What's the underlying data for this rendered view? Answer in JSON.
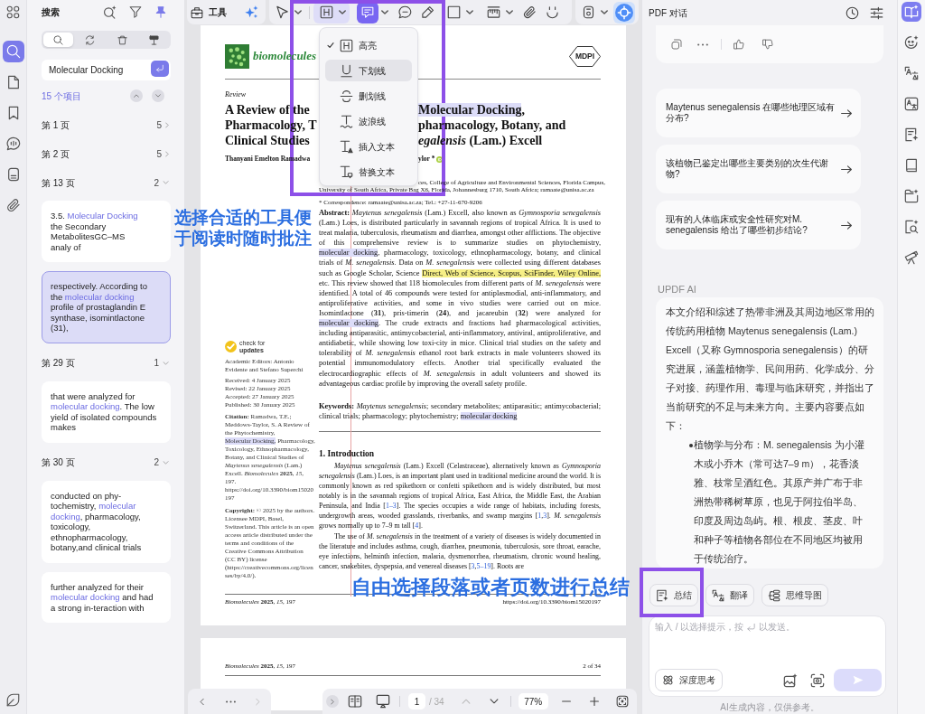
{
  "left_rail": [
    {
      "kind": "search",
      "selected": true
    },
    {
      "kind": "pages",
      "selected": false
    },
    {
      "kind": "bookmark",
      "selected": false
    },
    {
      "kind": "comment",
      "selected": false
    },
    {
      "kind": "form",
      "selected": false
    },
    {
      "kind": "attachment",
      "selected": false
    }
  ],
  "search_panel": {
    "title": "搜索",
    "scopes": [
      {
        "kind": "search",
        "selected": true
      },
      {
        "kind": "replace",
        "selected": false
      },
      {
        "kind": "delete",
        "selected": false
      },
      {
        "kind": "redact",
        "selected": false
      }
    ],
    "query": "Molecular Docking",
    "result_count": "15 个项目",
    "groups": [
      {
        "label": "第 1 页",
        "count": "5",
        "expanded": false
      },
      {
        "label": "第 2 页",
        "count": "5",
        "expanded": false
      },
      {
        "label": "第 13 页",
        "count": "2",
        "expanded": true,
        "results": [
          {
            "before": "3.5. ",
            "match": "Molecular Docking",
            "after": " the Secondary MetabolitesGC–MS analy of",
            "selected": false
          },
          {
            "before": "respectively. According to the ",
            "match": "molecular docking",
            "after": " profile of prostaglandin E synthase, isomintlactone (31),",
            "selected": true
          }
        ]
      },
      {
        "label": "第 29 页",
        "count": "1",
        "expanded": true,
        "results": [
          {
            "before": "that were analyzed for ",
            "match": "molecular docking",
            "after": ". The low yield of isolated compounds makes",
            "selected": false
          }
        ]
      },
      {
        "label": "第 30 页",
        "count": "2",
        "expanded": true,
        "results": [
          {
            "before": "conducted on phy-tochemistry, ",
            "match": "molecular docking",
            "after": ", pharmacology, toxicology, ethnopharmacology, botany,and clinical trials",
            "selected": false
          },
          {
            "before": "further analyzed for their ",
            "match": "molecular docking",
            "after": " and had a strong in-teraction with",
            "selected": false
          }
        ]
      }
    ]
  },
  "toolbar": {
    "tools_label": "工具",
    "tools": [
      {
        "kind": "select",
        "dropdown": true,
        "selected": false
      },
      {
        "kind": "highlight",
        "dropdown": true,
        "selected": false,
        "expanded": true
      },
      {
        "kind": "note",
        "dropdown": true,
        "selected": true
      },
      {
        "kind": "comment",
        "selected": false
      },
      {
        "kind": "pencil",
        "selected": false
      },
      {
        "kind": "shape",
        "dropdown": true,
        "selected": false
      },
      {
        "kind": "measure",
        "dropdown": true,
        "selected": false
      },
      {
        "kind": "attach",
        "selected": false
      },
      {
        "kind": "sticker",
        "selected": false
      }
    ],
    "extra_tools": [
      {
        "kind": "stamp",
        "dropdown": true,
        "selected": false
      },
      {
        "kind": "ai",
        "selected": true
      }
    ]
  },
  "markup_menu": [
    {
      "kind": "highlight",
      "label": "高亮",
      "checked": true,
      "selected": false
    },
    {
      "kind": "underline",
      "label": "下划线",
      "checked": false,
      "selected": true
    },
    {
      "kind": "strikeout",
      "label": "删划线",
      "checked": false,
      "selected": false
    },
    {
      "kind": "squiggly",
      "label": "波浪线",
      "checked": false,
      "selected": false
    },
    {
      "kind": "insert",
      "label": "插入文本",
      "checked": false,
      "selected": false
    },
    {
      "kind": "replace",
      "label": "替换文本",
      "checked": false,
      "selected": false
    }
  ],
  "document": {
    "journal": "biomolecules",
    "publisher": "MDPI",
    "article_type": "Review",
    "title_lines": [
      {
        "left": "A Review of the",
        "right": [
          {
            "kind": "highlight",
            "text": "Molecular Docking",
            "color": "#dcdcf8"
          },
          {
            "kind": "text",
            "text": ","
          }
        ]
      },
      {
        "left": "Pharmacology, T",
        "right": [
          {
            "kind": "text",
            "text": "pharmacology, Botany, and"
          }
        ]
      },
      {
        "left": "Clinical Studies",
        "right": [
          {
            "kind": "text",
            "text": "*egalensis* (Lam.) Excell"
          }
        ]
      }
    ],
    "authors": {
      "left": "Thanyani Emelton Ramadwa",
      "right": "ylor *"
    },
    "affiliations": [
      {
        "kind": "partial",
        "text": "ces, College of Agriculture and Environmental Sciences, Florida Campus,"
      },
      {
        "kind": "full",
        "text": "University of South Africa, Private Bag X6, Florida, Johannesburg 1710, South Africa; ramaate@unisa.ac.za"
      },
      {
        "kind": "full",
        "text": "* Correspondence: ramaate@unisa.ac.za; Tel.: +27-11-670-9206"
      }
    ],
    "side_notes": {
      "badge": "check for **updates**",
      "editors": "Academic Editors: Antonio Evidente and Stefano Superchi",
      "dates": [
        "Received: 4 January 2025",
        "Revised: 22 January 2025",
        "Accepted: 27 January 2025",
        "Published: 30 January 2025"
      ],
      "citation": [
        {
          "kind": "text",
          "text": "**Citation:** Ramadwa, T.E.; Meddows-Taylor, S. A Review of the Phytochemistry, "
        },
        {
          "kind": "highlight",
          "text": "Molecular Docking,",
          "color": "#dcdcf8"
        },
        {
          "kind": "text",
          "text": " Pharmacology, Toxicology, Ethnopharmacology, Botany, and Clinical Studies of *Maytenus senegalensis* (Lam.) Excell. *Biomolecules* **2025**, *15*, 197. https://doi.org/10.3390/biom15020197"
        }
      ],
      "copyright": "**Copyright:** © 2025 by the authors. Licensee MDPI, Basel, Switzerland. This article is an open access article distributed under the terms and conditions of the Creative Commons Attribution (CC BY) license (https://creativecommons.org/licenses/by/4.0/)."
    },
    "abstract": [
      {
        "kind": "text",
        "text": "**Abstract:** *Maytenus senegalensis* (Lam.) Excell, also known as *Gymnosporia senegalensis* (Lam.) Loes, is distributed particularly in savannah regions of tropical Africa. It is used to treat malaria, tuberculosis, rheumatism and diarrhea, amongst other afflictions. The objective of this comprehensive review is to summarize studies on phytochemistry, "
      },
      {
        "kind": "highlight",
        "text": "molecular docking",
        "color": "#dcdcf8"
      },
      {
        "kind": "text",
        "text": ", pharmacology, toxicology, ethnopharmacology, botany, and clinical trials of *M. senegalensis*. Data on *M. senegalensis* were collected using different databases such as Google Scholar, Science "
      },
      {
        "kind": "highlight",
        "text": "Direct, Web of Science, Scopus, SciFinder, Wiley Online,",
        "color": "#f6ef86"
      },
      {
        "kind": "text",
        "text": " etc. This review showed that 118 biomolecules from different parts of *M. senegalensis* were identified. A total of 46 compounds were tested for antiplasmodial, anti-inflammatory, and antiproliferative activities, and some in vivo studies were carried out on mice. Isomintlactone (**31**), pris-timerin (**24**), and jacareubin (**32**) were analyzed for "
      },
      {
        "kind": "highlight",
        "text": "molecular docking",
        "color": "#dcdcf8"
      },
      {
        "kind": "text",
        "text": ". The crude extracts and fractions had pharmacological activities, including antiparasitic, antimycobacterial, anti-inflammatory, antiviral, antiproliferative, and antidiabetic, while showing low toxi-city in mice. Clinical trial studies on the safety and tolerability of *M. senegalensis* ethanol root bark extracts in male volunteers showed its potential immunomodulatory effects. Another trial specifically evaluated the electrocardiographic effects of *M. senegalensis* in adult volunteers and showed its advantageous cardiac profile by improving the overall safety profile."
      }
    ],
    "keywords": [
      {
        "kind": "text",
        "text": "**Keywords:** *Maytenus senegalensis*; secondary metabolites; antiparasitic; antimycobacterial; clinical trials; pharmacology; phytochemistry; "
      },
      {
        "kind": "highlight",
        "text": "molecular docking",
        "color": "#dcdcf8"
      }
    ],
    "section_heading": "1. Introduction",
    "paragraphs": [
      [
        {
          "kind": "text",
          "text": "*Maytenus senegalensis* (Lam.) Excell (Celastraceae), alternatively known as *Gymnosporia senegalensis* (Lam.) Loes, is an important plant used in traditional medicine around the world. It is commonly known as red spikethorn or confetti spikethorn and is widely distributed, but most notably is in the savannah regions of tropical Africa, East Africa, the Middle East, the Arabian Peninsula, and India ["
        },
        {
          "kind": "link",
          "text": "1–3"
        },
        {
          "kind": "text",
          "text": "]. The species occupies a wide range of habitats, including forests, undergrowth areas, wooded grasslands, riverbanks, and swamp margins ["
        },
        {
          "kind": "link",
          "text": "1"
        },
        {
          "kind": "text",
          "text": ","
        },
        {
          "kind": "link",
          "text": "3"
        },
        {
          "kind": "text",
          "text": "]. *M. senegalensis* grows normally up to 7–9 m tall ["
        },
        {
          "kind": "link",
          "text": "4"
        },
        {
          "kind": "text",
          "text": "]."
        }
      ],
      [
        {
          "kind": "text",
          "text": "The use of *M. senegalensis* in the treatment of a variety of diseases is widely documented in the literature and includes asthma, cough, diarrhea, pneumonia, tuberculosis, sore throat, earache, eye infections, helminth infection, malaria, dysmenorrhea, rheumatism, chronic wound healing, cancer, snakebites, dyspepsia, and venereal diseases ["
        },
        {
          "kind": "link",
          "text": "3"
        },
        {
          "kind": "text",
          "text": ","
        },
        {
          "kind": "link",
          "text": "5–19"
        },
        {
          "kind": "text",
          "text": "]. Roots are"
        }
      ]
    ],
    "footer": {
      "left": "*Biomolecules* **2025**, *15*, 197",
      "right": "https://doi.org/10.3390/biom15020197"
    }
  },
  "next_page": {
    "header_left": "*Biomolecules* **2025**, *15*, 197",
    "header_right": "2 of 34"
  },
  "page_nav": {
    "current_page": "1",
    "total_pages": "/ 34",
    "zoom": "77%"
  },
  "chat_panel": {
    "title": "PDF 对话",
    "suggestions": [
      {
        "text": "Maytenus senegalensis 在哪些地理区域有分布?"
      },
      {
        "text": "该植物已鉴定出哪些主要类别的次生代谢物?"
      },
      {
        "text": "现有的人体临床或安全性研究对M. senegalensis 给出了哪些初步结论?"
      }
    ],
    "assistant_label": "UPDF AI",
    "answer": "本文介绍和综述了热带非洲及其周边地区常用的传统药用植物 Maytenus senegalensis (Lam.) Excell（又称 Gymnosporia senegalensis）的研究进展，涵盖植物学、民间用药、化学成分、分子对接、药理作用、毒理与临床研究，并指出了当前研究的不足与未来方向。主要内容要点如下：",
    "answer_points": [
      "植物学与分布：M. senegalensis 为小灌木或小乔木（常可达7–9 m），花香淡雅、枝常呈酒红色。其原产并广布于非洲热带稀树草原，也见于阿拉伯半岛、印度及周边岛屿。根、根皮、茎皮、叶和种子等植物各部位在不同地区均被用于传统治疗。"
    ],
    "actions": [
      {
        "kind": "summarize",
        "label": "总结"
      },
      {
        "kind": "translate",
        "label": "翻译"
      },
      {
        "kind": "mindmap",
        "label": "思维导图"
      }
    ],
    "input": {
      "placeholder": [
        "输入 / 以选择提示，按",
        "以发送。"
      ]
    },
    "deep_think": "深度思考",
    "send_disabled": true,
    "disclaimer": "AI生成内容，仅供参考。"
  },
  "right_rail": [
    {
      "kind": "reader",
      "selected": true
    },
    {
      "kind": "chat",
      "selected": false
    },
    {
      "kind": "translate",
      "selected": false
    },
    {
      "kind": "convert",
      "selected": false
    },
    {
      "kind": "summary",
      "selected": false
    },
    {
      "kind": "book",
      "selected": false
    },
    {
      "kind": "folder",
      "selected": false
    },
    {
      "kind": "inspect",
      "selected": false
    },
    {
      "kind": "telescope",
      "selected": false
    }
  ],
  "callouts": [
    {
      "text": "选择合适的工具便于阅读时随时批注"
    },
    {
      "text": "自由选择段落或者页数进行总结"
    }
  ]
}
